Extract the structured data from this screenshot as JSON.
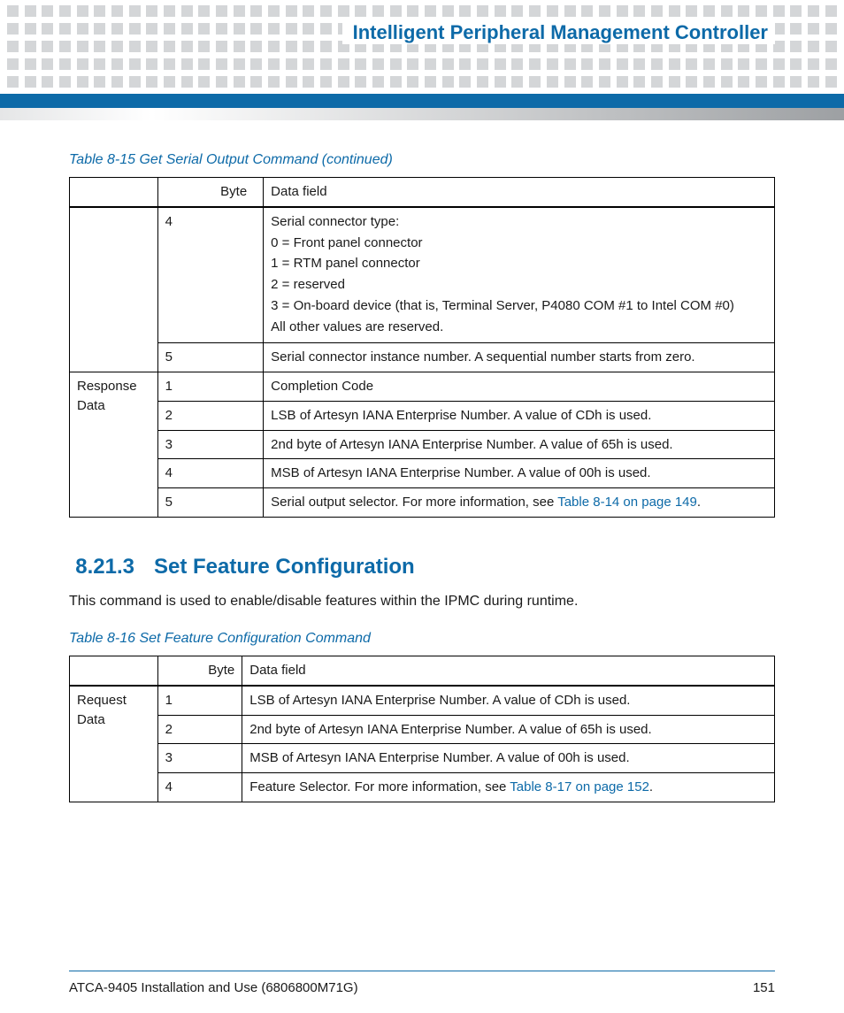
{
  "header": {
    "title": "Intelligent Peripheral Management Controller"
  },
  "table1": {
    "caption": "Table 8-15 Get Serial Output Command (continued)",
    "head": {
      "c0": "",
      "c1": "Byte",
      "c2": "Data field"
    },
    "row_a": {
      "byte": "4",
      "l0": "Serial connector type:",
      "l1": "0 = Front panel connector",
      "l2": "1 = RTM panel connector",
      "l3": "2 = reserved",
      "l4": "3 = On-board device (that is, Terminal Server, P4080 COM #1 to Intel COM #0)",
      "l5": "All other values are reserved."
    },
    "row_b": {
      "byte": "5",
      "data": "Serial connector instance number. A sequential number starts from zero."
    },
    "group_label": "Response Data",
    "row_c": {
      "byte": "1",
      "data": "Completion Code"
    },
    "row_d": {
      "byte": "2",
      "data": "LSB of Artesyn IANA Enterprise Number. A value of CDh is used."
    },
    "row_e": {
      "byte": "3",
      "data": "2nd byte of Artesyn IANA Enterprise Number. A value of 65h is used."
    },
    "row_f": {
      "byte": "4",
      "data": "MSB of Artesyn IANA Enterprise Number. A value of 00h is used."
    },
    "row_g": {
      "byte": "5",
      "pre": "Serial output selector. For more information, see ",
      "link": "Table 8-14 on page 149",
      "post": "."
    }
  },
  "section": {
    "num": "8.21.3",
    "title": "Set Feature Configuration",
    "body": "This command is used to enable/disable features within the IPMC during runtime."
  },
  "table2": {
    "caption": "Table 8-16 Set Feature Configuration Command",
    "head": {
      "c0": "",
      "c1": "Byte",
      "c2": "Data field"
    },
    "group_label": "Request Data",
    "row_a": {
      "byte": "1",
      "data": "LSB of Artesyn IANA Enterprise Number. A value of CDh is used."
    },
    "row_b": {
      "byte": "2",
      "data": "2nd byte of Artesyn IANA Enterprise Number. A value of 65h is used."
    },
    "row_c": {
      "byte": "3",
      "data": "MSB of Artesyn IANA Enterprise Number. A value of 00h is used."
    },
    "row_d": {
      "byte": "4",
      "pre": "Feature Selector. For more information, see ",
      "link": "Table 8-17 on page 152",
      "post": "."
    }
  },
  "footer": {
    "left": "ATCA-9405 Installation and Use (6806800M71G)",
    "right": "151"
  }
}
